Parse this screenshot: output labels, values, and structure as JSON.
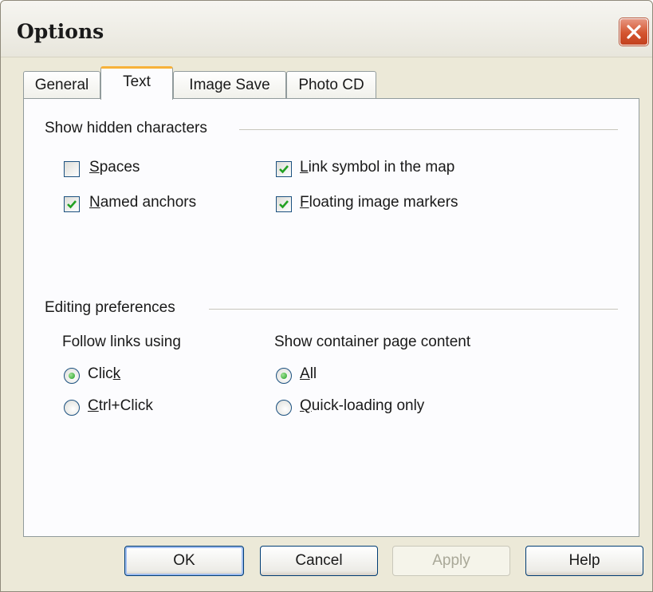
{
  "window": {
    "title": "Options"
  },
  "tabs": [
    {
      "label": "General",
      "active": false
    },
    {
      "label": "Text",
      "active": true
    },
    {
      "label": "Image Save",
      "active": false
    },
    {
      "label": "Photo CD",
      "active": false
    }
  ],
  "hidden_chars": {
    "group_label": "Show hidden characters",
    "options": [
      {
        "label": "Spaces",
        "checked": false
      },
      {
        "label": "Named anchors",
        "checked": true
      },
      {
        "label": "Link symbol in the map",
        "checked": true
      },
      {
        "label": "Floating image markers",
        "checked": true
      }
    ]
  },
  "editing": {
    "group_label": "Editing preferences",
    "follow_links": {
      "label": "Follow links using",
      "options": [
        {
          "label": "Click",
          "selected": true
        },
        {
          "label": "Ctrl+Click",
          "selected": false
        }
      ]
    },
    "container_content": {
      "label": "Show container page content",
      "options": [
        {
          "label": "All",
          "selected": true
        },
        {
          "label": "Quick-loading only",
          "selected": false
        }
      ]
    }
  },
  "buttons": {
    "ok": "OK",
    "cancel": "Cancel",
    "apply": "Apply",
    "help": "Help"
  },
  "icons": {
    "close": "close-icon",
    "check": "checkmark-icon"
  },
  "colors": {
    "accent_tab": "#f7b23a",
    "check_green": "#21a121",
    "close_red": "#d4552f"
  }
}
